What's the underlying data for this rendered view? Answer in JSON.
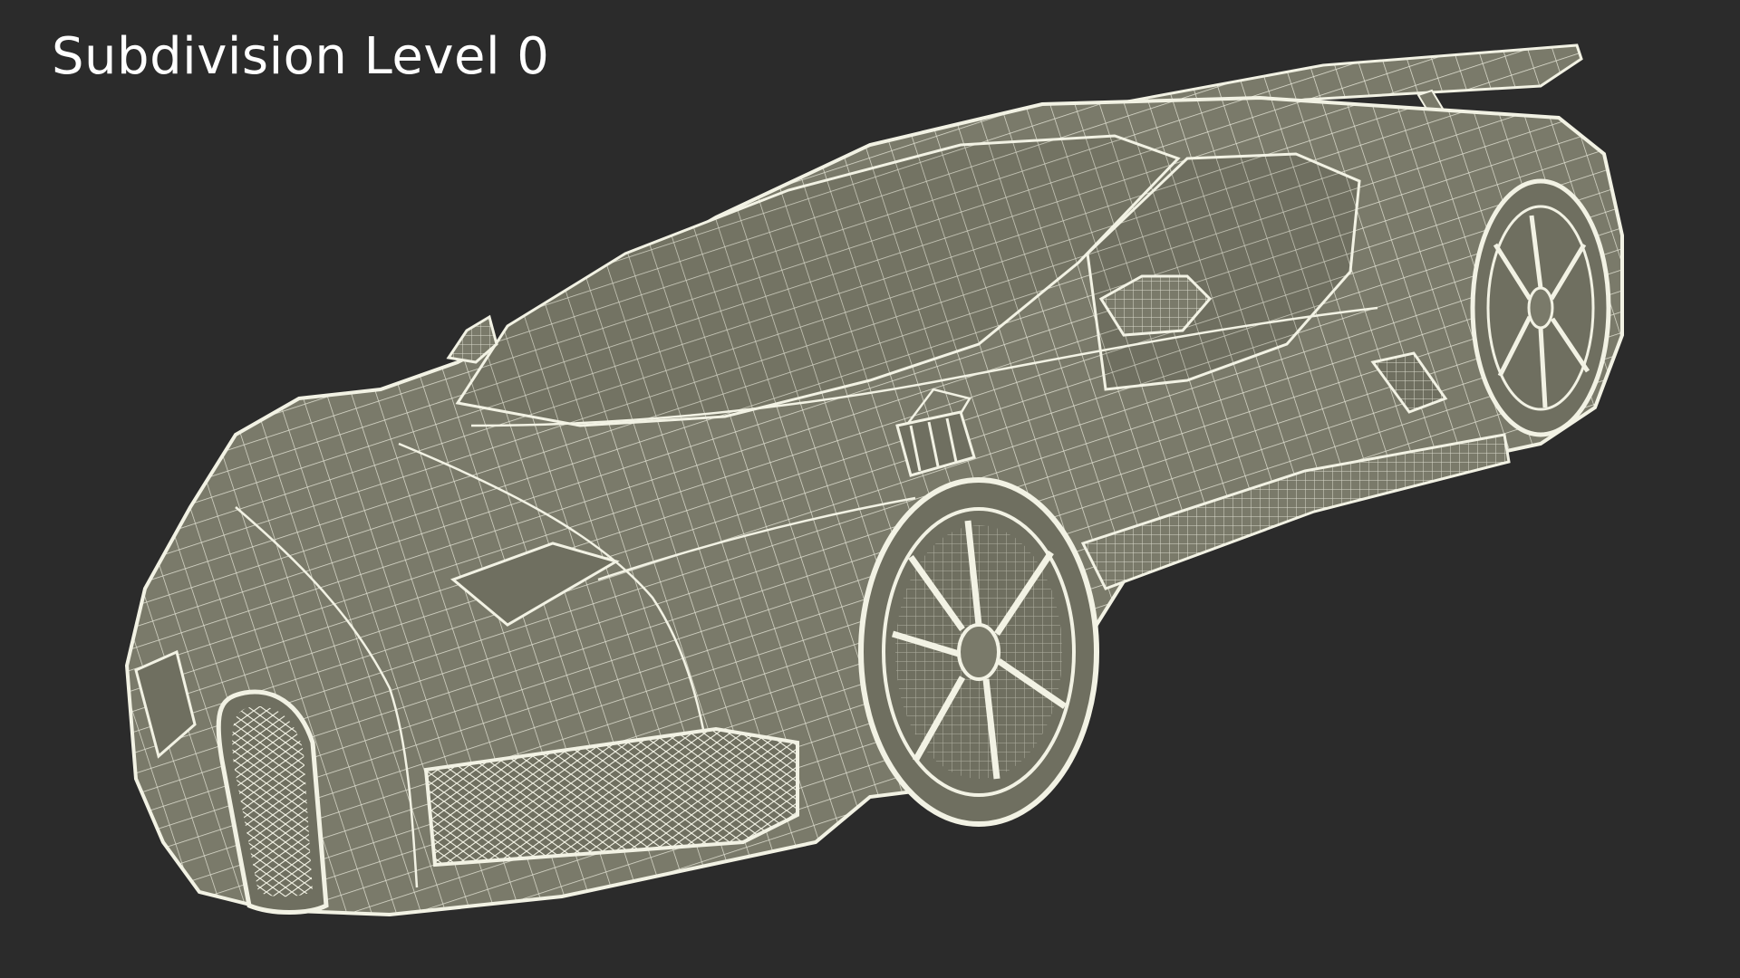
{
  "viewport": {
    "title": "Subdivision Level 0",
    "background_color": "#2b2b2b"
  },
  "render": {
    "subject": "sports car wireframe",
    "surface_color": "#7a7a6a",
    "wire_color": "#f2f2e4"
  }
}
